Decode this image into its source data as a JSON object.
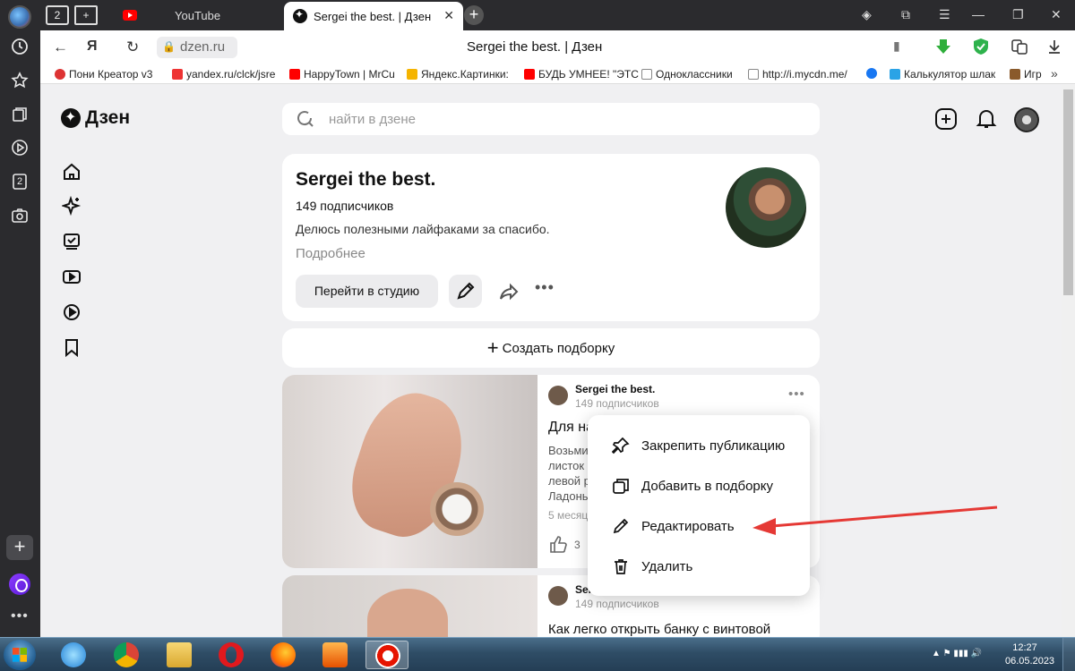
{
  "browser": {
    "tab_counter": "2",
    "tabs": [
      {
        "label": "YouTube"
      },
      {
        "label": "Sergei the best. | Дзен"
      }
    ],
    "address": {
      "url": "dzen.ru",
      "page_title": "Sergei the best. | Дзен"
    },
    "bookmarks": [
      {
        "label": "Пони Креатор v3",
        "color": "#d33"
      },
      {
        "label": "yandex.ru/clck/jsre",
        "color": "#e33"
      },
      {
        "label": "HappyTown | MrCu",
        "color": "#f00"
      },
      {
        "label": "Яндекс.Картинки:",
        "color": "#f5b400"
      },
      {
        "label": "БУДЬ УМНЕЕ! \"ЭТС",
        "color": "#f00"
      },
      {
        "label": "Одноклассники",
        "color": "#888"
      },
      {
        "label": "http://i.mycdn.me/",
        "color": "#888"
      },
      {
        "label": "Калькулятор шлак",
        "color": "#1877f2"
      },
      {
        "label": "Игр",
        "color": "#8a5a2b"
      }
    ],
    "sidebar_badge": "2"
  },
  "dzen": {
    "logo": "Дзен",
    "search_placeholder": "найти в дзене",
    "profile": {
      "name": "Sergei the best.",
      "subscribers": "149 подписчиков",
      "description": "Делюсь полезными лайфаками за спасибо.",
      "more": "Подробнее",
      "studio_button": "Перейти в студию"
    },
    "create_collection": "Создать подборку",
    "posts": [
      {
        "author": "Sergei the best.",
        "author_subscribers": "149 подписчиков",
        "title": "Для на",
        "body": "Возьми\nлисток с\nлевой р\nЛадонь",
        "date": "5 месяц",
        "likes": "3"
      },
      {
        "author": "Ser",
        "author_subscribers": "149 подписчиков",
        "title": "Как легко открыть банку с винтовой"
      }
    ],
    "context_menu": [
      {
        "label": "Закрепить публикацию",
        "icon": "pin-icon"
      },
      {
        "label": "Добавить в подборку",
        "icon": "copy-icon"
      },
      {
        "label": "Редактировать",
        "icon": "pencil-icon"
      },
      {
        "label": "Удалить",
        "icon": "trash-icon"
      }
    ]
  },
  "taskbar": {
    "time": "12:27",
    "date": "06.05.2023"
  },
  "colors": {
    "arrow": "#e53935",
    "accent_green": "#1e9e3e"
  }
}
